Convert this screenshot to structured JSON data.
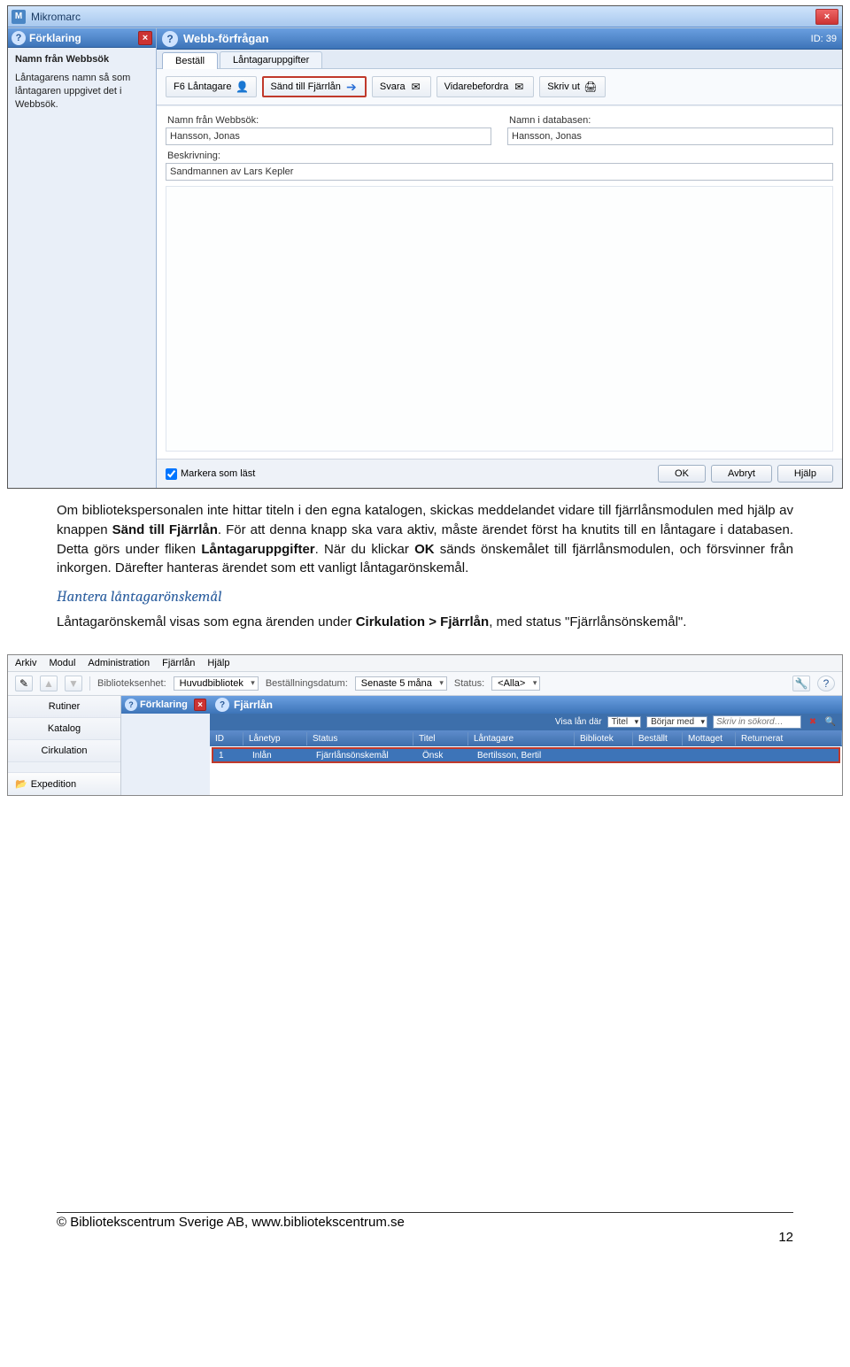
{
  "win1": {
    "app_title": "Mikromarc",
    "side_title": "Förklaring",
    "side_heading": "Namn från Webbsök",
    "side_text": "Låntagarens namn så som låntagaren uppgivet det i Webbsök.",
    "main_title": "Webb-förfrågan",
    "id_label": "ID: 39",
    "tabs": {
      "t1": "Beställ",
      "t2": "Låntagaruppgifter"
    },
    "toolbar": {
      "lantagare": "F6 Låntagare",
      "send": "Sänd till Fjärrlån",
      "svara": "Svara",
      "vidare": "Vidarebefordra",
      "skriv": "Skriv ut"
    },
    "form": {
      "namn_webb_lbl": "Namn från Webbsök:",
      "namn_webb_val": "Hansson, Jonas",
      "namn_db_lbl": "Namn i databasen:",
      "namn_db_val": "Hansson, Jonas",
      "beskr_lbl": "Beskrivning:",
      "beskr_val": "Sandmannen av Lars Kepler"
    },
    "chk_label": "Markera som läst",
    "btn_ok": "OK",
    "btn_avbryt": "Avbryt",
    "btn_hjalp": "Hjälp"
  },
  "doc": {
    "p1a": "Om bibliotekspersonalen inte hittar titeln i den egna katalogen, skickas meddelandet vidare till fjärrlånsmodulen med hjälp av knappen ",
    "p1b": "Sänd till Fjärrlån",
    "p1c": ". För att denna knapp ska vara aktiv, måste ärendet först ha knutits till en låntagare i databasen. Detta görs under fliken ",
    "p1d": "Låntagaruppgifter",
    "p1e": ". När du klickar ",
    "p1f": "OK",
    "p1g": " sänds önskemålet till fjärrlånsmodulen, och försvinner från inkorgen. Därefter hanteras ärendet som ett vanligt låntagarönskemål.",
    "h3": "Hantera låntagarönskemål",
    "p2a": "Låntagarönskemål visas som egna ärenden under ",
    "p2b": "Cirkulation > Fjärrlån",
    "p2c": ", med status \"Fjärrlånsönskemål\"."
  },
  "win2": {
    "menu": {
      "arkiv": "Arkiv",
      "modul": "Modul",
      "admin": "Administration",
      "fjarr": "Fjärrlån",
      "hjalp": "Hjälp"
    },
    "tb": {
      "enhet_lbl": "Biblioteksenhet:",
      "enhet_val": "Huvudbibliotek",
      "datum_lbl": "Beställningsdatum:",
      "datum_val": "Senaste 5 måna",
      "status_lbl": "Status:",
      "status_val": "<Alla>"
    },
    "side_title": "Förklaring",
    "main_title": "Fjärrlån",
    "filter": {
      "visa": "Visa lån där",
      "titel": "Titel",
      "borjar": "Börjar med",
      "sok_ph": "Skriv in sökord…"
    },
    "cols": {
      "id": "ID",
      "ty": "Lånetyp",
      "st": "Status",
      "ti": "Titel",
      "lt": "Låntagare",
      "bi": "Bibliotek",
      "be": "Beställt",
      "mo": "Mottaget",
      "re": "Returnerat"
    },
    "row": {
      "id": "1",
      "ty": "Inlån",
      "st": "Fjärrlånsönskemål",
      "st2": "Önsk",
      "lt": "Bertilsson, Bertil"
    },
    "nav": {
      "rutiner": "Rutiner",
      "katalog": "Katalog",
      "cirk": "Cirkulation",
      "exp": "Expedition"
    }
  },
  "footer": {
    "copy": "© Bibliotekscentrum Sverige AB, www.bibliotekscentrum.se",
    "page": "12"
  }
}
